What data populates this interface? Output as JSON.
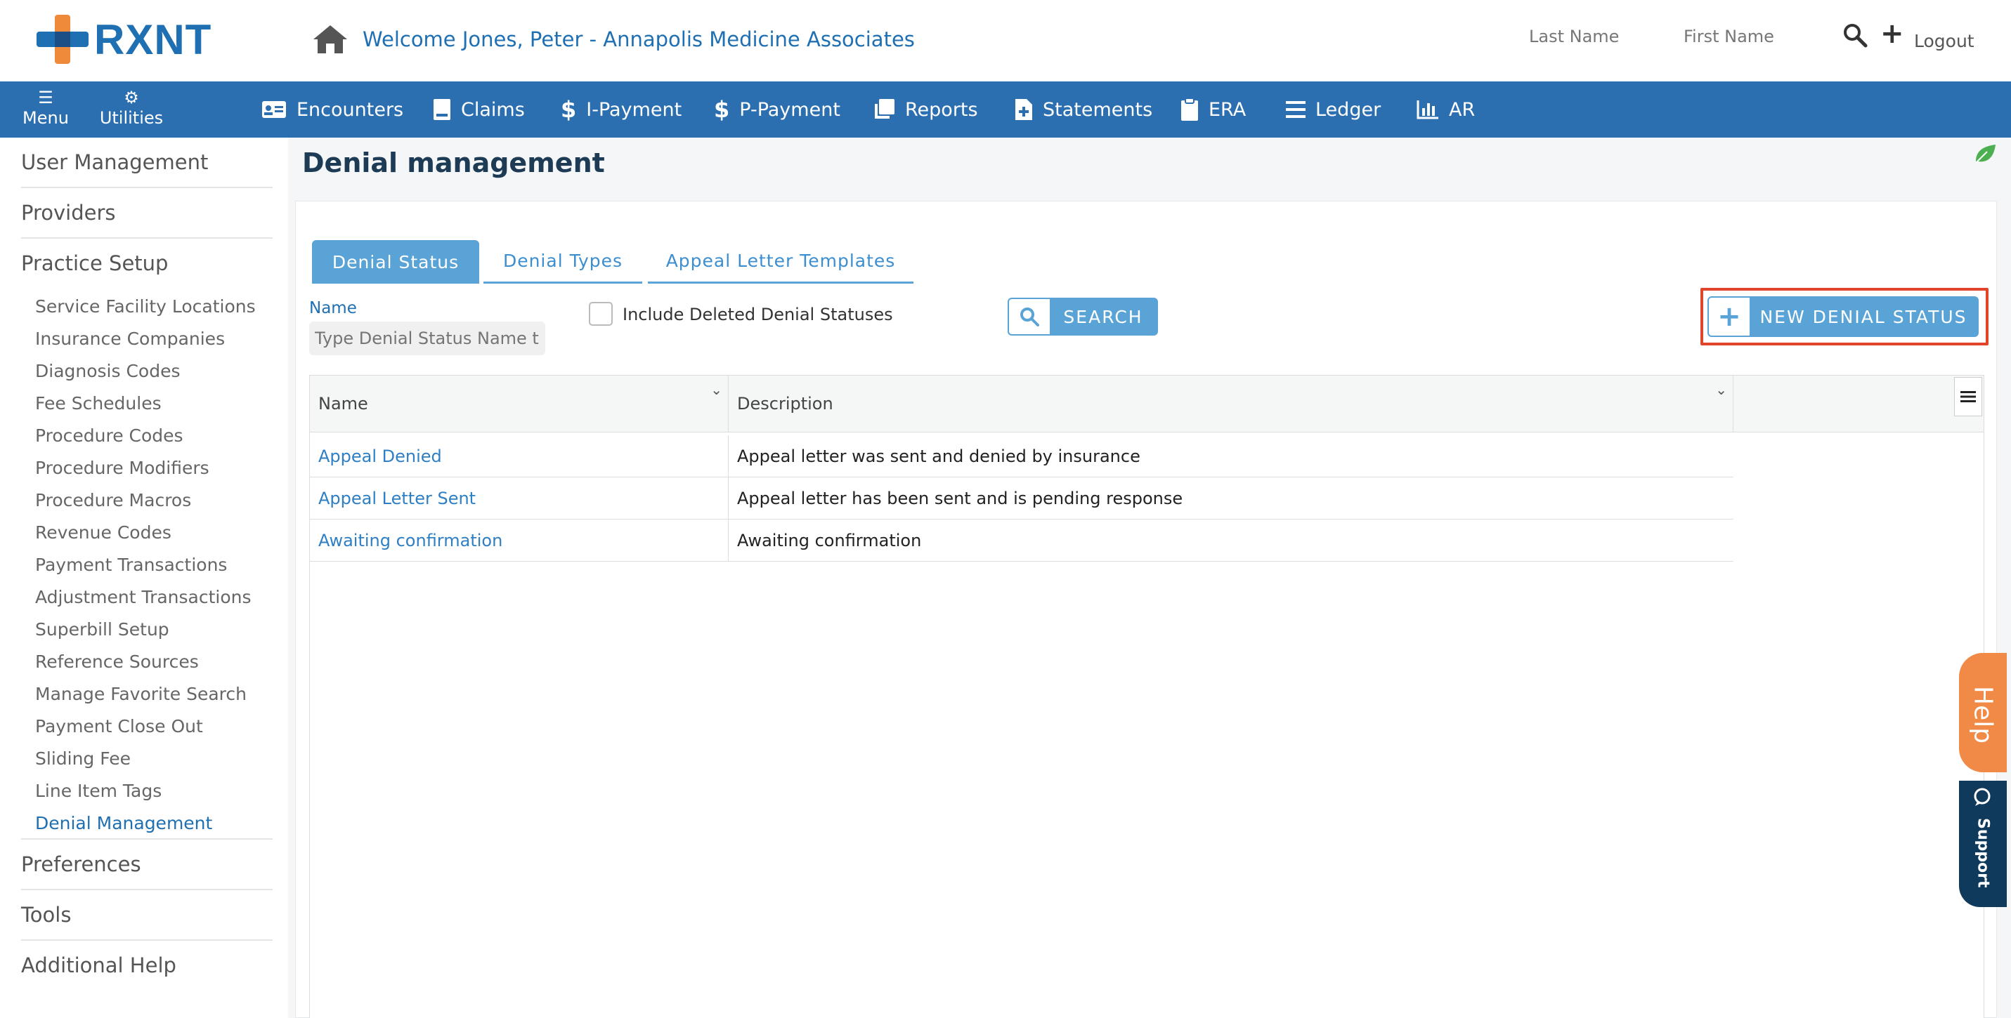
{
  "header": {
    "logo_text": "RXNT",
    "welcome": "Welcome Jones, Peter - Annapolis Medicine Associates",
    "last_name_label": "Last Name",
    "first_name_label": "First Name",
    "logout": "Logout"
  },
  "navbar": {
    "menu": "Menu",
    "utilities": "Utilities",
    "items": [
      "Encounters",
      "Claims",
      "I-Payment",
      "P-Payment",
      "Reports",
      "Statements",
      "ERA",
      "Ledger",
      "AR"
    ]
  },
  "sidebar": {
    "top": [
      "User Management",
      "Providers",
      "Practice Setup"
    ],
    "practice_setup_items": [
      "Service Facility Locations",
      "Insurance Companies",
      "Diagnosis Codes",
      "Fee Schedules",
      "Procedure Codes",
      "Procedure Modifiers",
      "Procedure Macros",
      "Revenue Codes",
      "Payment Transactions",
      "Adjustment Transactions",
      "Superbill Setup",
      "Reference Sources",
      "Manage Favorite Search",
      "Payment Close Out",
      "Sliding Fee",
      "Line Item Tags",
      "Denial Management"
    ],
    "bottom": [
      "Preferences",
      "Tools",
      "Additional Help"
    ]
  },
  "page": {
    "title": "Denial management",
    "tabs": [
      "Denial Status",
      "Denial Types",
      "Appeal Letter Templates"
    ],
    "name_label": "Name",
    "name_placeholder": "Type Denial Status Name to s",
    "include_deleted": "Include Deleted Denial Statuses",
    "search_button": "SEARCH",
    "new_button": "NEW DENIAL STATUS"
  },
  "grid": {
    "columns": [
      "Name",
      "Description"
    ],
    "rows": [
      {
        "name": "Appeal Denied",
        "description": "Appeal letter was sent and denied by insurance"
      },
      {
        "name": "Appeal Letter Sent",
        "description": "Appeal letter has been sent and is pending response"
      },
      {
        "name": "Awaiting confirmation",
        "description": "Awaiting confirmation"
      }
    ]
  },
  "side_tabs": {
    "help": "Help",
    "support": "Support"
  },
  "colors": {
    "brand_blue": "#2b6fb0",
    "accent_blue": "#59a3d6",
    "highlight_red": "#e0452b",
    "help_orange": "#f28a47",
    "support_navy": "#0f3a5c"
  }
}
